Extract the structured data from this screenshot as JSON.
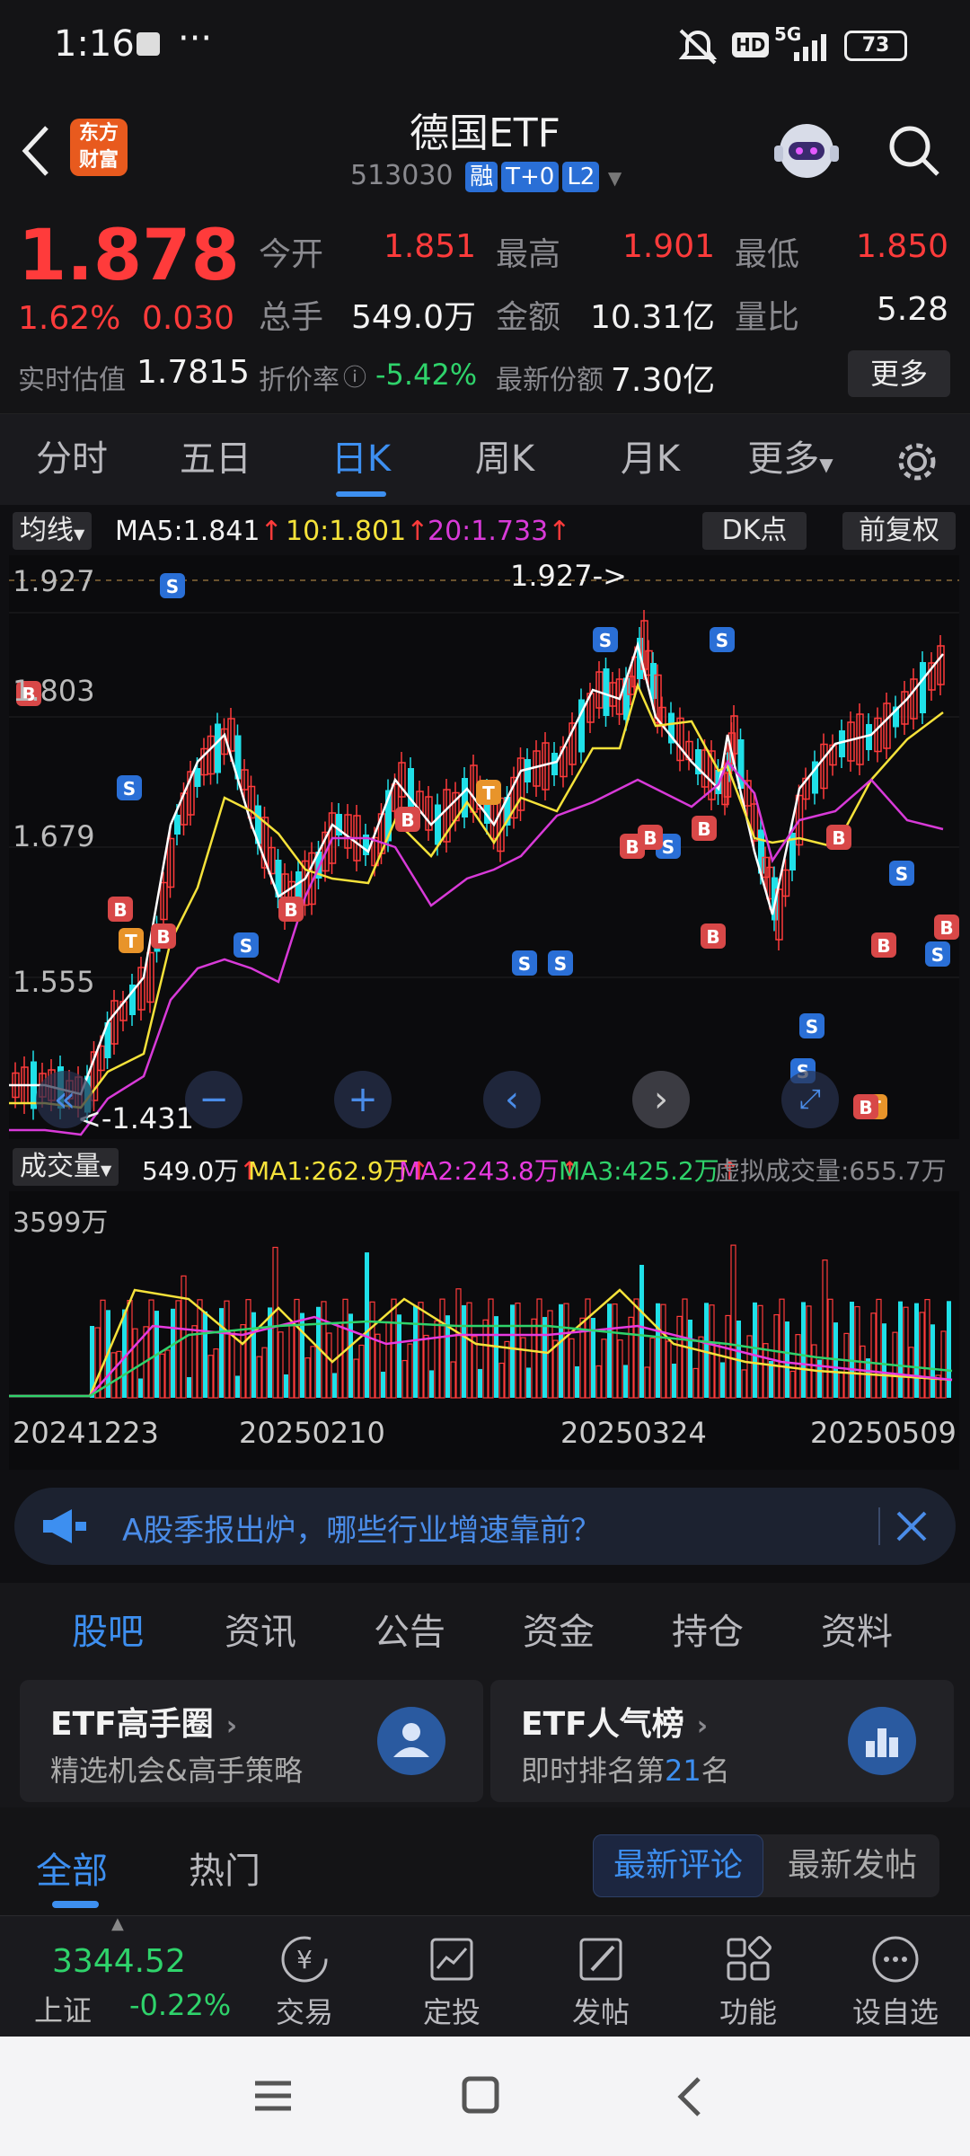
{
  "status_bar": {
    "time": "1:16",
    "dots": "···",
    "network": "5G",
    "hd": "HD",
    "battery": "73"
  },
  "header": {
    "logo_line1": "东方",
    "logo_line2": "财富",
    "title": "德国ETF",
    "code": "513030",
    "tag_margin": "融",
    "tag_t0": "T+0",
    "tag_l2": "L2"
  },
  "quote": {
    "price": "1.878",
    "change_pct": "1.62%",
    "change": "0.030",
    "open_label": "今开",
    "open": "1.851",
    "high_label": "最高",
    "high": "1.901",
    "low_label": "最低",
    "low": "1.850",
    "volume_label": "总手",
    "volume": "549.0万",
    "amount_label": "金额",
    "amount": "10.31亿",
    "ratio_label": "量比",
    "ratio": "5.28",
    "iopv_label": "实时估值",
    "iopv": "1.7815",
    "discount_label": "折价率",
    "discount": "-5.42%",
    "shares_label": "最新份额",
    "shares": "7.30亿",
    "more_button": "更多"
  },
  "period_tabs": {
    "items": [
      "分时",
      "五日",
      "日K",
      "周K",
      "月K"
    ],
    "more": "更多",
    "active": "日K"
  },
  "chart_bar": {
    "ma_selector": "均线",
    "ma5": "MA5:1.841",
    "ma10": "10:1.801",
    "ma20": "20:1.733",
    "dk": "DK点",
    "adjust": "前复权"
  },
  "kline": {
    "y_labels": [
      "1.927",
      "1.803",
      "1.679",
      "1.555",
      "1.431"
    ],
    "max_marker": "1.927->",
    "min_marker": "<-1.431"
  },
  "vol_bar": {
    "selector": "成交量",
    "vol": "549.0万",
    "ma1": "MA1:262.9万",
    "ma2": "MA2:243.8万",
    "ma3": "MA3:425.2万",
    "virtual": "虚拟成交量:655.7万",
    "max_label": "3599万"
  },
  "dates": [
    "20241223",
    "20250210",
    "20250324",
    "20250509"
  ],
  "banner": {
    "text": "A股季报出炉，哪些行业增速靠前？"
  },
  "sub_tabs": {
    "items": [
      "股吧",
      "资讯",
      "公告",
      "资金",
      "持仓",
      "资料"
    ],
    "active": "股吧"
  },
  "cards": [
    {
      "title": "ETF高手圈",
      "subtitle": "精选机会&高手策略"
    },
    {
      "title": "ETF人气榜",
      "subtitle_pre": "即时排名第",
      "rank": "21",
      "subtitle_post": "名"
    }
  ],
  "filter": {
    "all": "全部",
    "hot": "热门",
    "latest_comment": "最新评论",
    "latest_post": "最新发帖"
  },
  "bottom_nav": {
    "index_value": "3344.52",
    "index_name": "上证",
    "index_change": "-0.22%",
    "items": [
      "交易",
      "定投",
      "发帖",
      "功能",
      "设自选"
    ]
  },
  "colors": {
    "up": "#ff3b3b",
    "down": "#1fe0e8",
    "ma5": "#ffffff",
    "ma10": "#f5e23a",
    "ma20": "#d83ad8",
    "accent": "#3d8ff0",
    "green": "#2fd36b"
  }
}
